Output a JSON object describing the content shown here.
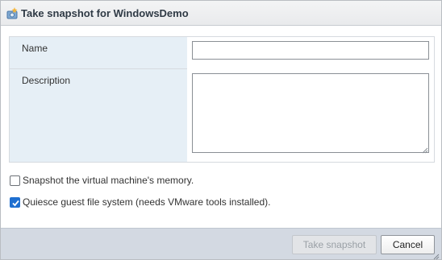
{
  "dialog": {
    "title": "Take snapshot for WindowsDemo",
    "title_icon": "snapshot-camera-icon"
  },
  "form": {
    "name_label": "Name",
    "name_value": "",
    "description_label": "Description",
    "description_value": ""
  },
  "options": {
    "memory_label": "Snapshot the virtual machine's memory.",
    "memory_checked": false,
    "quiesce_label": "Quiesce guest file system (needs VMware tools installed).",
    "quiesce_checked": true
  },
  "footer": {
    "take_snapshot_label": "Take snapshot",
    "take_snapshot_enabled": false,
    "cancel_label": "Cancel"
  },
  "colors": {
    "label_bg": "#e6eff6",
    "footer_bg": "#d3d9e2",
    "checkbox_accent": "#1e6fd0"
  }
}
